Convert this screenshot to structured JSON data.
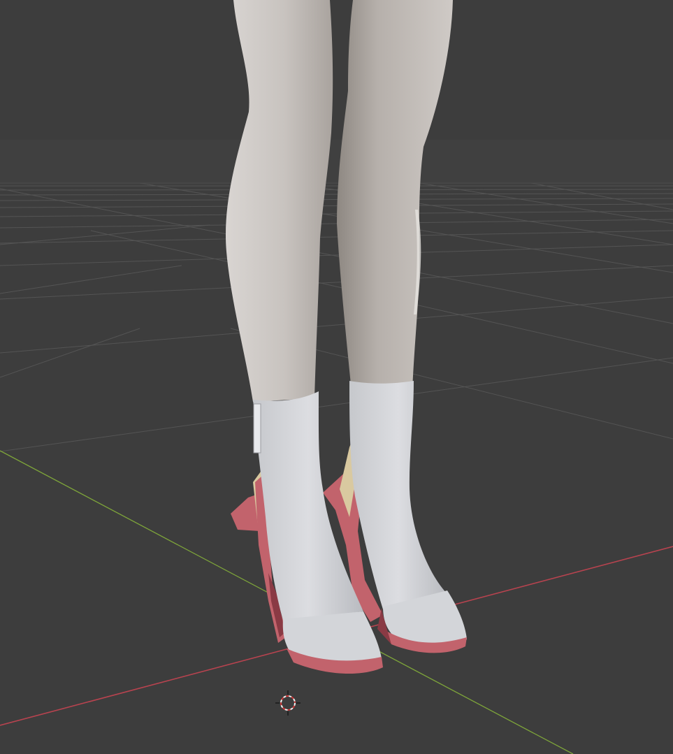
{
  "viewport": {
    "mode": "3d-viewport",
    "background_color": "#3d3d3d",
    "grid_line_color": "#575757",
    "x_axis_color": "#b8434f",
    "y_axis_color": "#7ea53a",
    "cursor_color_a": "#d23a3a",
    "cursor_color_b": "#f2f2f2"
  },
  "model": {
    "leg_color": "#c9c4c0",
    "leg_shadow_color": "#a7a19c",
    "boot_color": "#d6d7db",
    "boot_shadow_color": "#b3b5ba",
    "heel_color": "#c2636c",
    "heel_dark_color": "#8a3a44",
    "accent_color": "#d9c9a0"
  }
}
